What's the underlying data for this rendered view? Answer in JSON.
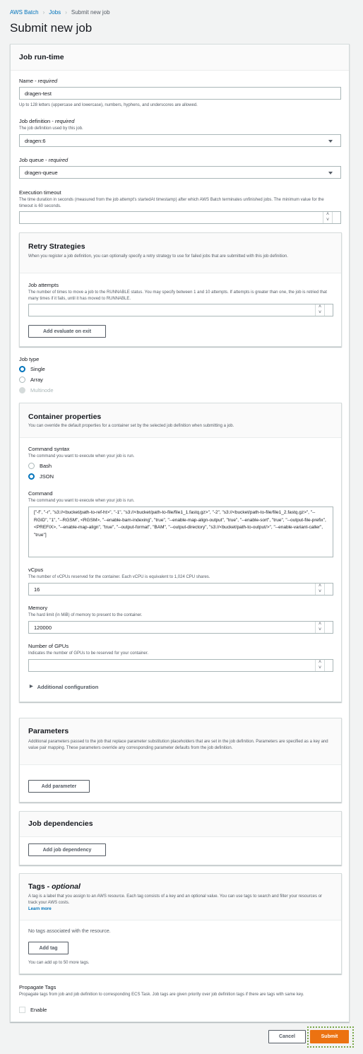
{
  "breadcrumb": [
    "AWS Batch",
    "Jobs",
    "Submit new job"
  ],
  "page_title": "Submit new job",
  "runtime": {
    "title": "Job run-time",
    "name_label": "Name - ",
    "required": "required",
    "name_value": "dragen-test",
    "name_help": "Up to 128 letters (uppercase and lowercase), numbers, hyphens, and underscores are allowed.",
    "jobdef_label": "Job definition - ",
    "jobdef_desc": "The job definition used by this job.",
    "jobdef_value": "dragen:6",
    "queue_label": "Job queue - ",
    "queue_value": "dragen-queue",
    "timeout_label": "Execution timeout",
    "timeout_desc": "The time duration in seconds (measured from the job attempt's startedAt timestamp) after which AWS Batch terminates unfinished jobs. The minimum value for the timeout is 60 seconds.",
    "timeout_value": ""
  },
  "retry": {
    "title": "Retry Strategies",
    "desc": "When you register a job definition, you can optionally specify a retry strategy to use for failed jobs that are submitted with this job definition.",
    "attempts_label": "Job attempts",
    "attempts_desc": "The number of times to move a job to the RUNNABLE status. You may specify between 1 and 10 attempts. If attempts is greater than one, the job is retried that many times if it fails, until it has moved to RUNNABLE.",
    "attempts_value": "",
    "add_button": "Add evaluate on exit"
  },
  "job_type": {
    "label": "Job type",
    "options": [
      "Single",
      "Array",
      "Multinode"
    ],
    "selected": "Single",
    "disabled": "Multinode"
  },
  "container": {
    "title": "Container properties",
    "desc": "You can override the default properties for a container set by the selected job definition when submitting a job.",
    "syntax_label": "Command syntax",
    "syntax_desc": "The command you want to execute when your job is run.",
    "syntax_options": [
      "Bash",
      "JSON"
    ],
    "syntax_selected": "JSON",
    "command_label": "Command",
    "command_desc": "The command you want to execute when your job is run.",
    "command_value": " [\"-f\", \"-r\", \"s3://<bucket/path-to-ref-ht>\", \"-1\", \"s3://<bucket/path-to-file/file1_1.fastq.gz>\", \"-2\", \"s3://<bucket/path-to-file/file1_2.fastq.gz>\", \"--RGID\", \"1\", \"--RGSM\", <RGSM>, \"--enable-bam-indexing\", \"true\", \"--enable-map-align-output\", \"true\", \"--enable-sort\", \"true\", \"--output-file-prefix\", <PREFIX>, \"--enable-map-align\", \"true\", \"--output-format\", \"BAM\", \"--output-directory\", \"s3://<bucket/path-to-output/>\", \"--enable-variant-caller\", \"true\"]",
    "vcpus_label": "vCpus",
    "vcpus_desc": "The number of vCPUs reserved for the container. Each vCPU is equivalent to 1,024 CPU shares.",
    "vcpus_value": "16",
    "memory_label": "Memory",
    "memory_desc": "The hard limit (in MiB) of memory to present to the container.",
    "memory_value": "120000",
    "gpus_label": "Number of GPUs",
    "gpus_desc": "Indicates the number of GPUs to be reserved for your container.",
    "gpus_value": "",
    "additional": "Additional configuration"
  },
  "parameters": {
    "title": "Parameters",
    "desc": "Additional parameters passed to the job that replace parameter substitution placeholders that are set in the job definition. Parameters are specified as a key and value pair mapping. These parameters override any corresponding parameter defaults from the job definition.",
    "add_button": "Add parameter"
  },
  "dependencies": {
    "title": "Job dependencies",
    "add_button": "Add job dependency"
  },
  "tags": {
    "title": "Tags - ",
    "optional": "optional",
    "desc": "A tag is a label that you assign to an AWS resource. Each tag consists of a key and an optional value. You can use tags to search and filter your resources or track your AWS costs.",
    "learn_more": "Learn more",
    "empty": "No tags associated with the resource.",
    "add_button": "Add tag",
    "limit": "You can add up to 50 more tags."
  },
  "propagate": {
    "label": "Propagate Tags",
    "desc": "Propagate tags from job and job definition to corresponding ECS Task. Job tags are given priority over job definition tags if there are tags with same key.",
    "checkbox": "Enable",
    "checked": false
  },
  "footer": {
    "cancel": "Cancel",
    "submit": "Submit"
  },
  "colors": {
    "accent": "#ec7211",
    "link": "#0073bb",
    "focus_outline": "#6a9a3a"
  }
}
